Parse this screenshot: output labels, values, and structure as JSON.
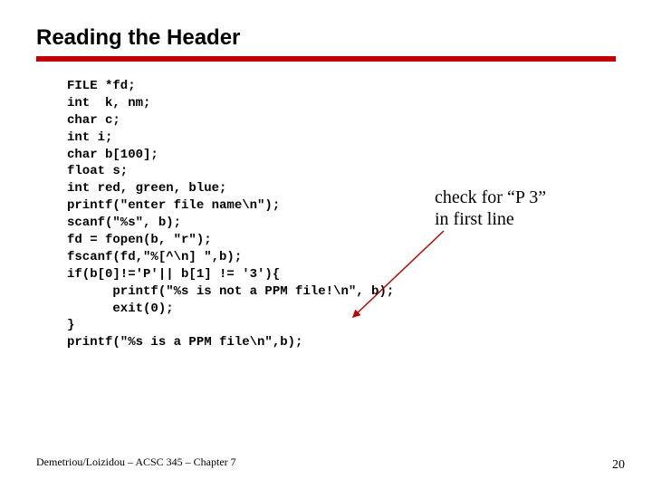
{
  "title": "Reading the Header",
  "code": "FILE *fd;\nint  k, nm;\nchar c;\nint i;\nchar b[100];\nfloat s;\nint red, green, blue;\nprintf(\"enter file name\\n\");\nscanf(\"%s\", b);\nfd = fopen(b, \"r\");\nfscanf(fd,\"%[^\\n] \",b);\nif(b[0]!='P'|| b[1] != '3'){\n      printf(\"%s is not a PPM file!\\n\", b);\n      exit(0);\n}\nprintf(\"%s is a PPM file\\n\",b);",
  "annotation_line1": "check for “P 3”",
  "annotation_line2": "in first line",
  "footer_left": "Demetriou/Loizidou – ACSC 345 – Chapter 7",
  "page_number": "20"
}
